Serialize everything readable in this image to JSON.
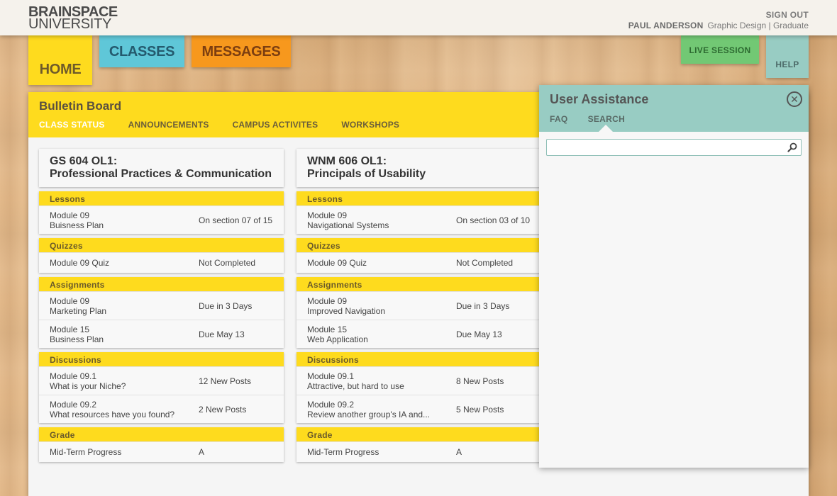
{
  "header": {
    "logo_line1": "BRAINSPACE",
    "logo_line2": "UNIVERSITY",
    "sign_out": "SIGN OUT",
    "user_name": "PAUL ANDERSON",
    "user_program": "Graphic Design | Graduate"
  },
  "nav": {
    "home": "HOME",
    "classes": "CLASSES",
    "messages": "MESSAGES",
    "live_session": "LIVE SESSION",
    "help": "HELP"
  },
  "board": {
    "title": "Bulletin Board",
    "tabs": [
      "CLASS STATUS",
      "ANNOUNCEMENTS",
      "CAMPUS ACTIVITES",
      "WORKSHOPS"
    ]
  },
  "classes": [
    {
      "code": "GS 604 OL1:",
      "name": "Professional Practices & Communication",
      "sections": [
        {
          "title": "Lessons",
          "rows": [
            {
              "l1": "Module 09",
              "l2": "Buisness Plan",
              "status": "On section 07 of 15"
            }
          ]
        },
        {
          "title": "Quizzes",
          "rows": [
            {
              "l1": "Module 09 Quiz",
              "l2": "",
              "status": "Not Completed"
            }
          ]
        },
        {
          "title": "Assignments",
          "rows": [
            {
              "l1": "Module 09",
              "l2": "Marketing Plan",
              "status": "Due in 3 Days"
            },
            {
              "l1": "Module 15",
              "l2": "Business Plan",
              "status": "Due May 13"
            }
          ]
        },
        {
          "title": "Discussions",
          "rows": [
            {
              "l1": "Module 09.1",
              "l2": "What is your Niche?",
              "status": "12 New Posts"
            },
            {
              "l1": "Module 09.2",
              "l2": "What resources have you found?",
              "status": "2 New Posts"
            }
          ]
        },
        {
          "title": "Grade",
          "rows": [
            {
              "l1": "Mid-Term Progress",
              "l2": "",
              "status": "A"
            }
          ]
        }
      ]
    },
    {
      "code": "WNM 606 OL1:",
      "name": "Principals of Usability",
      "sections": [
        {
          "title": "Lessons",
          "rows": [
            {
              "l1": "Module 09",
              "l2": "Navigational Systems",
              "status": "On section 03 of 10"
            }
          ]
        },
        {
          "title": "Quizzes",
          "rows": [
            {
              "l1": "Module 09 Quiz",
              "l2": "",
              "status": "Not Completed"
            }
          ]
        },
        {
          "title": "Assignments",
          "rows": [
            {
              "l1": "Module 09",
              "l2": "Improved Navigation",
              "status": "Due in 3 Days"
            },
            {
              "l1": "Module 15",
              "l2": "Web Application",
              "status": "Due May 13"
            }
          ]
        },
        {
          "title": "Discussions",
          "rows": [
            {
              "l1": "Module 09.1",
              "l2": "Attractive, but hard to use",
              "status": "8 New Posts"
            },
            {
              "l1": "Module 09.2",
              "l2": "Review another group's IA and...",
              "status": "5 New Posts"
            }
          ]
        },
        {
          "title": "Grade",
          "rows": [
            {
              "l1": "Mid-Term Progress",
              "l2": "",
              "status": "A"
            }
          ]
        }
      ]
    }
  ],
  "assistance": {
    "title": "User Assistance",
    "tabs": [
      "FAQ",
      "SEARCH"
    ],
    "search_value": "",
    "close_icon": "close-circle-icon",
    "search_icon": "magnifier-icon"
  },
  "colors": {
    "yellow": "#fedb1e",
    "teal": "#98ccc3",
    "blue": "#5fc7d8",
    "orange": "#f7981d",
    "green": "#72c874"
  }
}
